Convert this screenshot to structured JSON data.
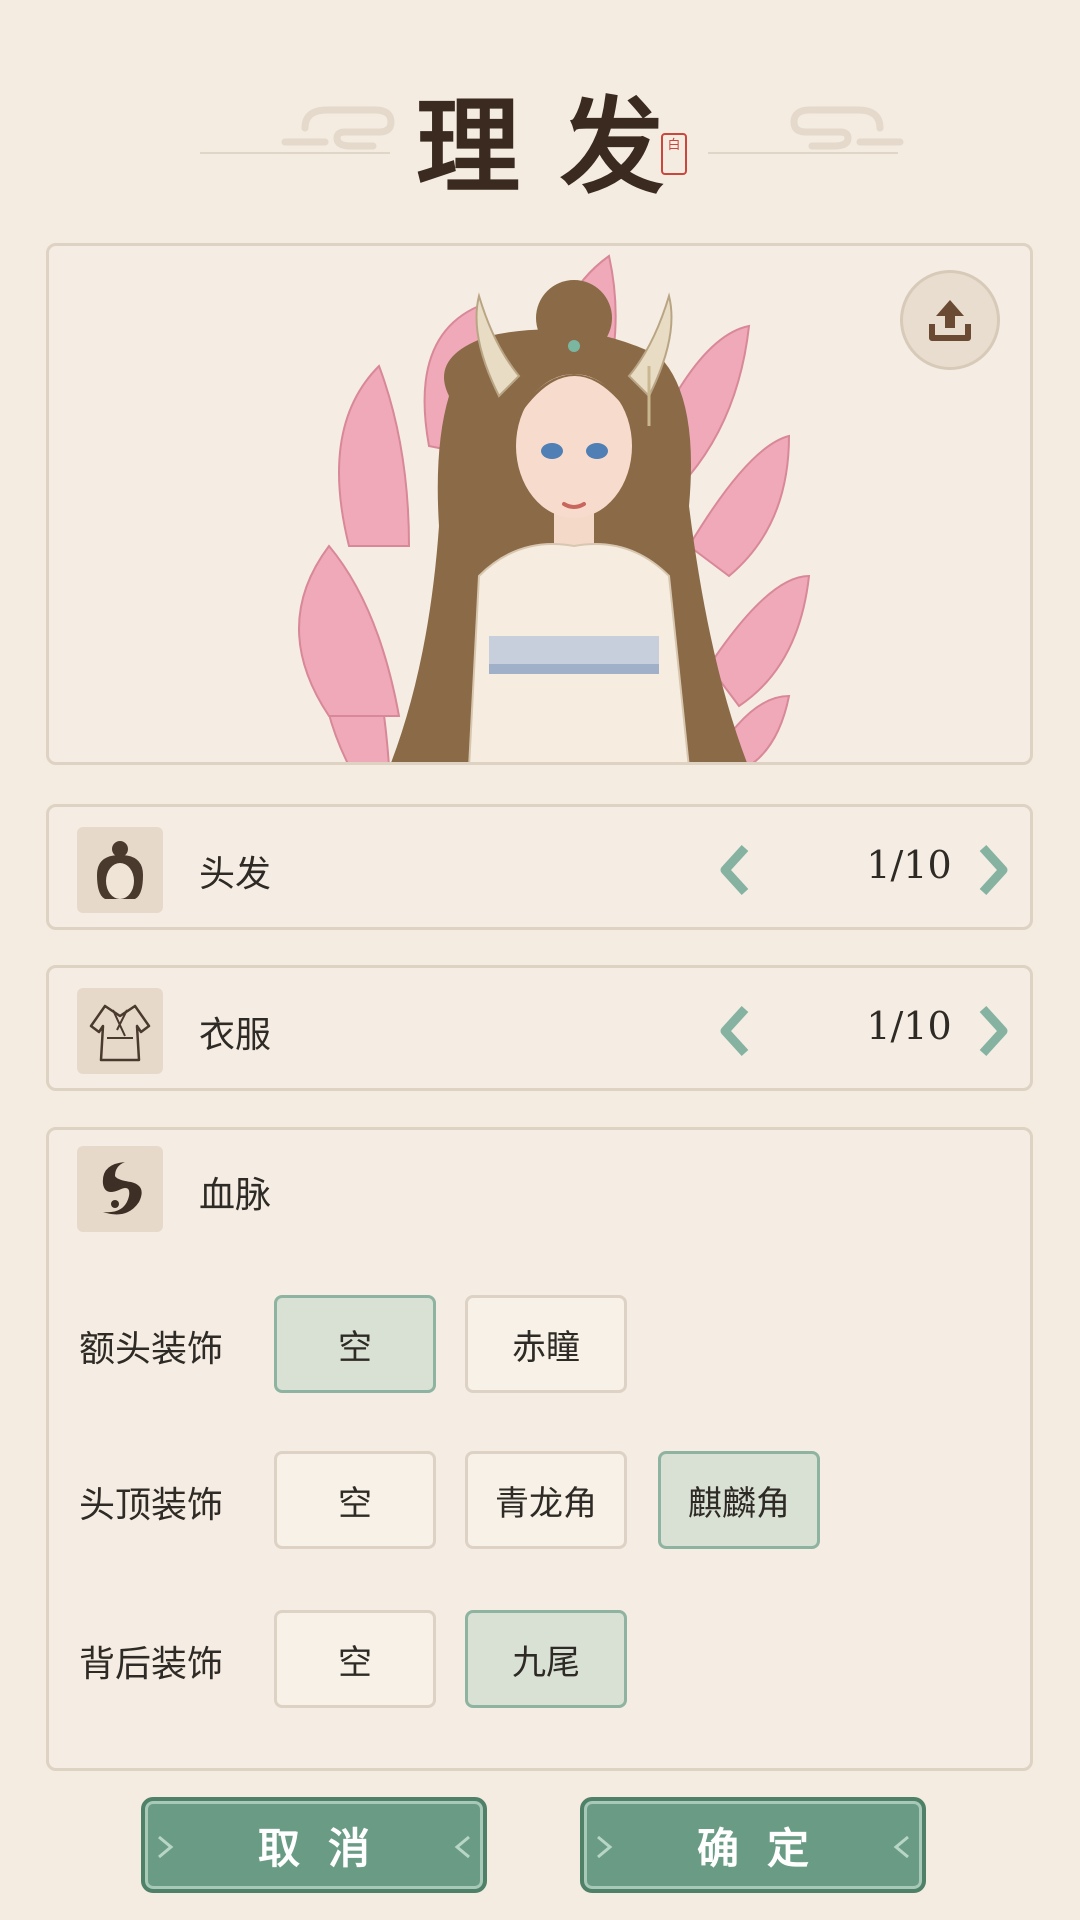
{
  "header": {
    "title": "理发",
    "seal": "白"
  },
  "preview": {
    "upload_icon": "upload-icon"
  },
  "rows": [
    {
      "label": "头发",
      "counter": "1/10",
      "icon": "hair-bun-icon"
    },
    {
      "label": "衣服",
      "counter": "1/10",
      "icon": "robe-icon"
    }
  ],
  "bloodline": {
    "label": "血脉",
    "icon": "taiji-swirl-icon",
    "groups": [
      {
        "label": "额头装饰",
        "options": [
          "空",
          "赤瞳"
        ],
        "selected": "空"
      },
      {
        "label": "头顶装饰",
        "options": [
          "空",
          "青龙角",
          "麒麟角"
        ],
        "selected": "麒麟角"
      },
      {
        "label": "背后装饰",
        "options": [
          "空",
          "九尾"
        ],
        "selected": "九尾"
      }
    ]
  },
  "actions": {
    "cancel": "取消",
    "confirm": "确定"
  },
  "colors": {
    "accent": "#6a9c85",
    "background": "#f4ece1",
    "arrow": "#86b3a1"
  }
}
